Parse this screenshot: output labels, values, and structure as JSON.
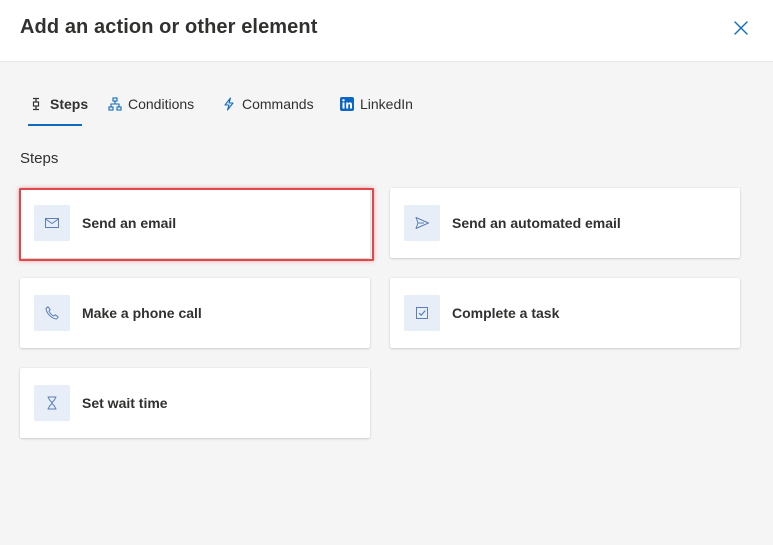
{
  "dialog": {
    "title": "Add an action or other element",
    "close_icon": "close-icon"
  },
  "tabs": [
    {
      "label": "Steps",
      "icon": "steps-icon",
      "active": true
    },
    {
      "label": "Conditions",
      "icon": "hierarchy-icon",
      "active": false
    },
    {
      "label": "Commands",
      "icon": "lightning-icon",
      "active": false
    },
    {
      "label": "LinkedIn",
      "icon": "linkedin-icon",
      "active": false
    }
  ],
  "section": {
    "title": "Steps"
  },
  "steps": [
    {
      "label": "Send an email",
      "icon": "mail-icon"
    },
    {
      "label": "Send an automated email",
      "icon": "send-icon"
    },
    {
      "label": "Make a phone call",
      "icon": "phone-icon"
    },
    {
      "label": "Complete a task",
      "icon": "checkbox-task-icon"
    },
    {
      "label": "Set wait time",
      "icon": "hourglass-icon"
    }
  ],
  "colors": {
    "accent": "#0f6cbd",
    "highlight": "#e2454a",
    "icon_tile": "#e7eef7",
    "linkedin": "#0a66c2"
  }
}
